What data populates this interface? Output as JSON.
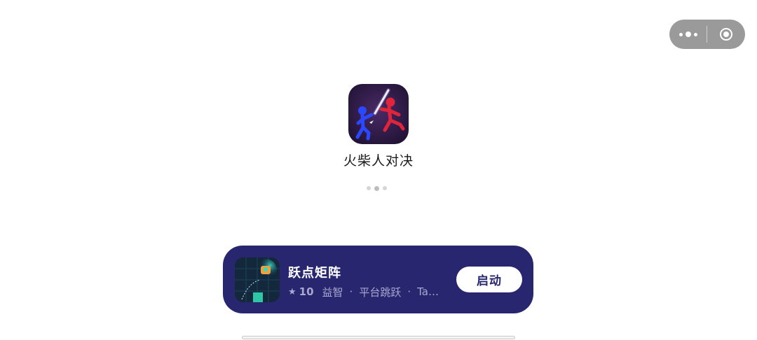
{
  "capsule": {
    "more_icon": "more-dots-icon",
    "close_icon": "target-close-icon"
  },
  "game": {
    "title": "火柴人对决",
    "icon": "stickman-duel-icon"
  },
  "recommendation": {
    "name": "跃点矩阵",
    "rating": "10",
    "tags": [
      "益智",
      "平台跳跃",
      "Ta…"
    ],
    "button_label": "启动",
    "background_color": "#27266f"
  }
}
